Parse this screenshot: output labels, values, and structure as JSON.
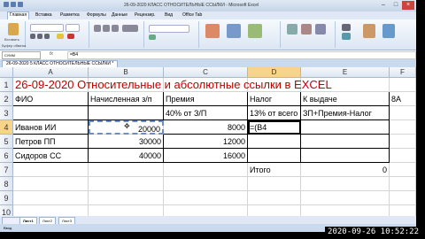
{
  "window": {
    "title": "26-09-2020 КЛАСС ОТНОСИТЕЛЬНЫЕ ССЫЛКИ - Microsoft Excel"
  },
  "menu": {
    "items": [
      "Главная",
      "Вставка",
      "Разметка",
      "Формулы",
      "Данные",
      "Рецензир.",
      "Вид",
      "Office Tab"
    ]
  },
  "ribbon": {
    "paste_label": "Вставить",
    "clipboard_label": "Буфер обмена"
  },
  "formula_bar": {
    "name_box": "СУММ",
    "fx": "fx",
    "value": "=B4"
  },
  "doc_tab": {
    "label": "26-09-2020 5 КЛАСС ОТНОСИТЕЛЬНЫЕ ССЫЛКИ *"
  },
  "columns": [
    "A",
    "B",
    "C",
    "D",
    "E",
    "F"
  ],
  "rows": [
    "1",
    "2",
    "3",
    "4",
    "5",
    "6",
    "7",
    "8",
    "9",
    "10"
  ],
  "sheet": {
    "title": "26-09-2020 Относительные и абсолютные ссылки в EXCEL",
    "headers": {
      "fio": "ФИО",
      "accrued": "Начисленная з/п",
      "bonus": "Премия",
      "tax": "Налог",
      "payout": "К выдаче",
      "class": "8А"
    },
    "notes": {
      "bonus": "40% от З/П",
      "tax": "13% от всего",
      "payout": "ЗП+Премия-Налог"
    },
    "people": [
      {
        "name": "Иванов ИИ",
        "accrued": "20000",
        "bonus": "8000",
        "tax": "=(B4"
      },
      {
        "name": "Петров ПП",
        "accrued": "30000",
        "bonus": "12000",
        "tax": ""
      },
      {
        "name": "Сидоров СС",
        "accrued": "40000",
        "bonus": "16000",
        "tax": ""
      }
    ],
    "total_label": "Итого",
    "total_value": "0"
  },
  "sheet_tabs": [
    "Лист1",
    "Лист2",
    "Лист3"
  ],
  "status": {
    "mode": "Ввод"
  },
  "overlay": {
    "timestamp": "2020-09-26 10:52:22"
  }
}
